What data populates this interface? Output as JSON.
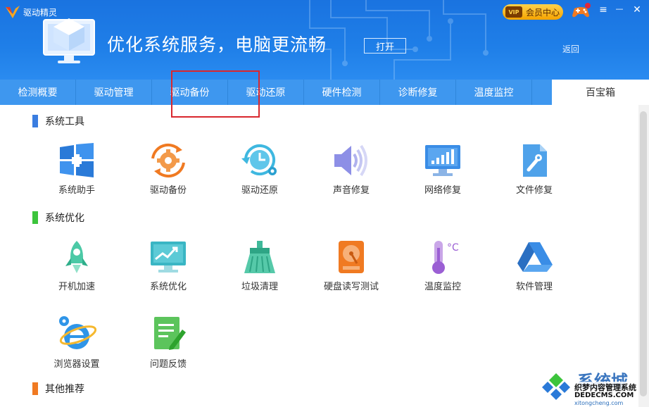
{
  "app": {
    "title": "驱动精灵"
  },
  "header": {
    "banner_text": "优化系统服务，电脑更流畅",
    "open_label": "打开",
    "back_label": "返回",
    "vip_badge": "VIP",
    "vip_label": "会员中心",
    "menu_icon": "≡",
    "minimize_icon": "—",
    "close_icon": "✕"
  },
  "tabs": [
    {
      "label": "检测概要"
    },
    {
      "label": "驱动管理"
    },
    {
      "label": "驱动备份"
    },
    {
      "label": "驱动还原"
    },
    {
      "label": "硬件检测"
    },
    {
      "label": "诊断修复"
    },
    {
      "label": "温度监控"
    },
    {
      "label": "百宝箱",
      "active": true
    }
  ],
  "sections": {
    "system_tools": {
      "title": "系统工具",
      "color": "#3a7de0",
      "items": [
        {
          "label": "系统助手",
          "icon": "windows-plus-icon"
        },
        {
          "label": "驱动备份",
          "icon": "gear-refresh-icon"
        },
        {
          "label": "驱动还原",
          "icon": "clock-restore-icon"
        },
        {
          "label": "声音修复",
          "icon": "speaker-icon"
        },
        {
          "label": "网络修复",
          "icon": "monitor-signal-icon"
        },
        {
          "label": "文件修复",
          "icon": "document-wrench-icon"
        }
      ]
    },
    "system_optimize": {
      "title": "系统优化",
      "color": "#3cc43c",
      "items": [
        {
          "label": "开机加速",
          "icon": "rocket-icon"
        },
        {
          "label": "系统优化",
          "icon": "monitor-chart-icon"
        },
        {
          "label": "垃圾清理",
          "icon": "broom-icon"
        },
        {
          "label": "硬盘读写测试",
          "icon": "hard-disk-icon"
        },
        {
          "label": "温度监控",
          "icon": "thermometer-icon"
        },
        {
          "label": "软件管理",
          "icon": "triangle-drive-icon"
        },
        {
          "label": "浏览器设置",
          "icon": "ie-gear-icon"
        },
        {
          "label": "问题反馈",
          "icon": "note-pencil-icon"
        }
      ]
    },
    "other": {
      "title": "其他推荐",
      "color": "#f07a22"
    }
  },
  "watermark": {
    "main": "系统城",
    "sub1": "织梦内容管理系统",
    "sub2": "DEDECMS.COM",
    "url": "xitongcheng.com"
  }
}
